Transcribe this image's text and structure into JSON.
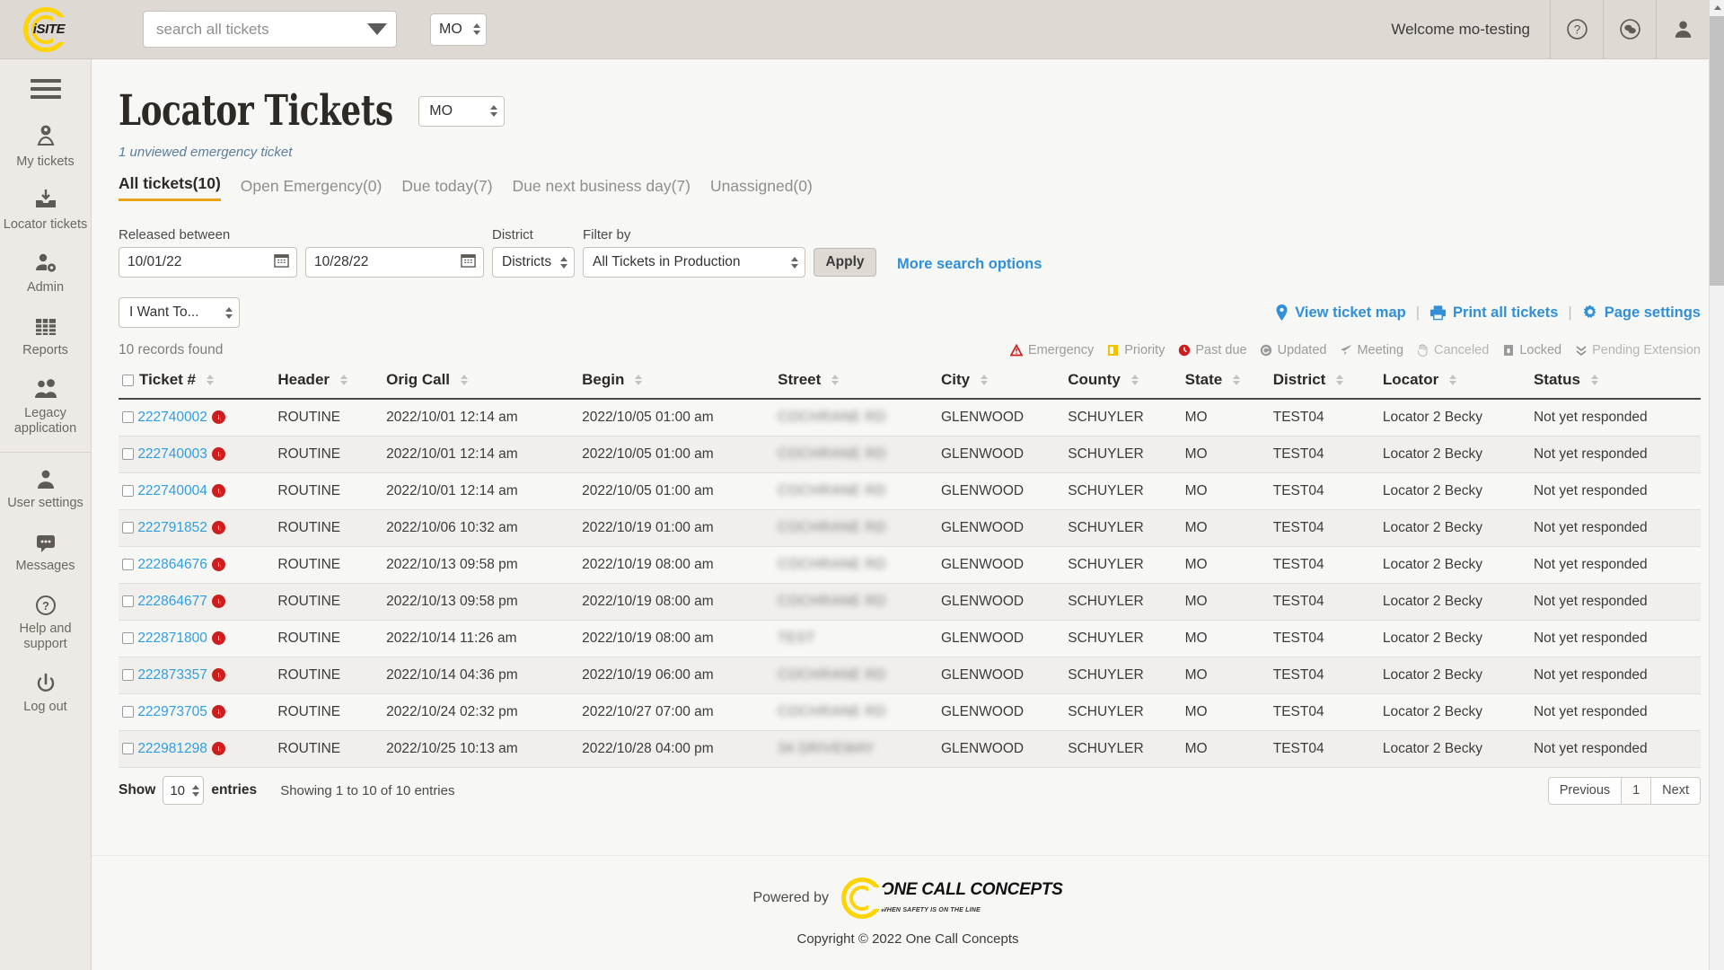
{
  "topbar": {
    "logo_label": "iSITE",
    "search_placeholder": "search all tickets",
    "state_value": "MO",
    "welcome": "Welcome mo-testing",
    "icons": {
      "help": "?",
      "chat": "chat",
      "user": "user"
    }
  },
  "sidebar": {
    "items": [
      {
        "label": "My tickets",
        "icon": "map-pin-person-icon"
      },
      {
        "label": "Locator tickets",
        "icon": "inbox-download-icon"
      },
      {
        "label": "Admin",
        "icon": "person-gear-icon"
      },
      {
        "label": "Reports",
        "icon": "grid-table-icon"
      },
      {
        "label": "Legacy application",
        "icon": "two-people-icon"
      },
      {
        "label": "User settings",
        "icon": "person-icon"
      },
      {
        "label": "Messages",
        "icon": "speech-bubble-icon"
      },
      {
        "label": "Help and support",
        "icon": "question-circle-icon"
      },
      {
        "label": "Log out",
        "icon": "power-icon"
      }
    ]
  },
  "page": {
    "title": "Locator Tickets",
    "state_select": "MO",
    "unviewed": "1 unviewed emergency ticket",
    "tabs": [
      {
        "label": "All tickets(10)",
        "active": true
      },
      {
        "label": "Open Emergency(0)",
        "active": false
      },
      {
        "label": "Due today(7)",
        "active": false
      },
      {
        "label": "Due next business day(7)",
        "active": false
      },
      {
        "label": "Unassigned(0)",
        "active": false
      }
    ]
  },
  "filters": {
    "released_between_label": "Released between",
    "date_from": "10/01/22",
    "date_to": "10/28/22",
    "district_label": "District",
    "district_value": "Districts",
    "filter_by_label": "Filter by",
    "filter_by_value": "All Tickets in Production",
    "apply_label": "Apply",
    "more_search_options": "More search options"
  },
  "actions": {
    "i_want_to": "I Want To...",
    "view_ticket_map": "View ticket map",
    "print_all_tickets": "Print all tickets",
    "page_settings": "Page settings",
    "divider": "|"
  },
  "legend": [
    {
      "label": "Emergency",
      "icon": "emergency-triangle-icon",
      "color": "#cc1e1e"
    },
    {
      "label": "Priority",
      "icon": "priority-flag-icon",
      "color": "#f2c200"
    },
    {
      "label": "Past due",
      "icon": "past-due-clock-icon",
      "color": "#cc1e1e"
    },
    {
      "label": "Updated",
      "icon": "updated-refresh-icon",
      "color": "#9b9b9b"
    },
    {
      "label": "Meeting",
      "icon": "meeting-paperplane-icon",
      "color": "#9b9b9b"
    },
    {
      "label": "Canceled",
      "icon": "canceled-hand-icon",
      "color": "#b5b5b5"
    },
    {
      "label": "Locked",
      "icon": "locked-padlock-icon",
      "color": "#9b9b9b"
    },
    {
      "label": "Pending Extension",
      "icon": "pending-extension-chevrons-icon",
      "color": "#b5b5b5"
    }
  ],
  "table": {
    "records_found": "10 records found",
    "columns": [
      "Ticket #",
      "Header",
      "Orig Call",
      "Begin",
      "Street",
      "City",
      "County",
      "State",
      "District",
      "Locator",
      "Status"
    ],
    "rows": [
      {
        "ticket": "222740002",
        "header": "ROUTINE",
        "orig_call": "2022/10/01 12:14 am",
        "begin": "2022/10/05 01:00 am",
        "street": "COCHRANE RD",
        "city": "GLENWOOD",
        "county": "SCHUYLER",
        "state": "MO",
        "district": "TEST04",
        "locator": "Locator 2 Becky",
        "status": "Not yet responded"
      },
      {
        "ticket": "222740003",
        "header": "ROUTINE",
        "orig_call": "2022/10/01 12:14 am",
        "begin": "2022/10/05 01:00 am",
        "street": "COCHRANE RD",
        "city": "GLENWOOD",
        "county": "SCHUYLER",
        "state": "MO",
        "district": "TEST04",
        "locator": "Locator 2 Becky",
        "status": "Not yet responded"
      },
      {
        "ticket": "222740004",
        "header": "ROUTINE",
        "orig_call": "2022/10/01 12:14 am",
        "begin": "2022/10/05 01:00 am",
        "street": "COCHRANE RD",
        "city": "GLENWOOD",
        "county": "SCHUYLER",
        "state": "MO",
        "district": "TEST04",
        "locator": "Locator 2 Becky",
        "status": "Not yet responded"
      },
      {
        "ticket": "222791852",
        "header": "ROUTINE",
        "orig_call": "2022/10/06 10:32 am",
        "begin": "2022/10/19 01:00 am",
        "street": "COCHRANE RD",
        "city": "GLENWOOD",
        "county": "SCHUYLER",
        "state": "MO",
        "district": "TEST04",
        "locator": "Locator 2 Becky",
        "status": "Not yet responded"
      },
      {
        "ticket": "222864676",
        "header": "ROUTINE",
        "orig_call": "2022/10/13 09:58 pm",
        "begin": "2022/10/19 08:00 am",
        "street": "COCHRANE RD",
        "city": "GLENWOOD",
        "county": "SCHUYLER",
        "state": "MO",
        "district": "TEST04",
        "locator": "Locator 2 Becky",
        "status": "Not yet responded"
      },
      {
        "ticket": "222864677",
        "header": "ROUTINE",
        "orig_call": "2022/10/13 09:58 pm",
        "begin": "2022/10/19 08:00 am",
        "street": "COCHRANE RD",
        "city": "GLENWOOD",
        "county": "SCHUYLER",
        "state": "MO",
        "district": "TEST04",
        "locator": "Locator 2 Becky",
        "status": "Not yet responded"
      },
      {
        "ticket": "222871800",
        "header": "ROUTINE",
        "orig_call": "2022/10/14 11:26 am",
        "begin": "2022/10/19 08:00 am",
        "street": "TEST",
        "city": "GLENWOOD",
        "county": "SCHUYLER",
        "state": "MO",
        "district": "TEST04",
        "locator": "Locator 2 Becky",
        "status": "Not yet responded"
      },
      {
        "ticket": "222873357",
        "header": "ROUTINE",
        "orig_call": "2022/10/14 04:36 pm",
        "begin": "2022/10/19 06:00 am",
        "street": "COCHRANE RD",
        "city": "GLENWOOD",
        "county": "SCHUYLER",
        "state": "MO",
        "district": "TEST04",
        "locator": "Locator 2 Becky",
        "status": "Not yet responded"
      },
      {
        "ticket": "222973705",
        "header": "ROUTINE",
        "orig_call": "2022/10/24 02:32 pm",
        "begin": "2022/10/27 07:00 am",
        "street": "COCHRANE RD",
        "city": "GLENWOOD",
        "county": "SCHUYLER",
        "state": "MO",
        "district": "TEST04",
        "locator": "Locator 2 Becky",
        "status": "Not yet responded"
      },
      {
        "ticket": "222981298",
        "header": "ROUTINE",
        "orig_call": "2022/10/25 10:13 am",
        "begin": "2022/10/28 04:00 pm",
        "street": "34 DRIVEWAY",
        "city": "GLENWOOD",
        "county": "SCHUYLER",
        "state": "MO",
        "district": "TEST04",
        "locator": "Locator 2 Becky",
        "status": "Not yet responded"
      }
    ]
  },
  "table_foot": {
    "show_label": "Show",
    "show_value": "10",
    "entries_label": "entries",
    "showing_text": "Showing 1 to 10 of 10 entries",
    "previous": "Previous",
    "page_1": "1",
    "next": "Next"
  },
  "footer": {
    "powered_by": "Powered by",
    "brand_main": "ONE CALL CONCEPTS",
    "brand_sub": "WHEN SAFETY IS ON THE LINE",
    "copyright": "Copyright © 2022 One Call Concepts"
  }
}
